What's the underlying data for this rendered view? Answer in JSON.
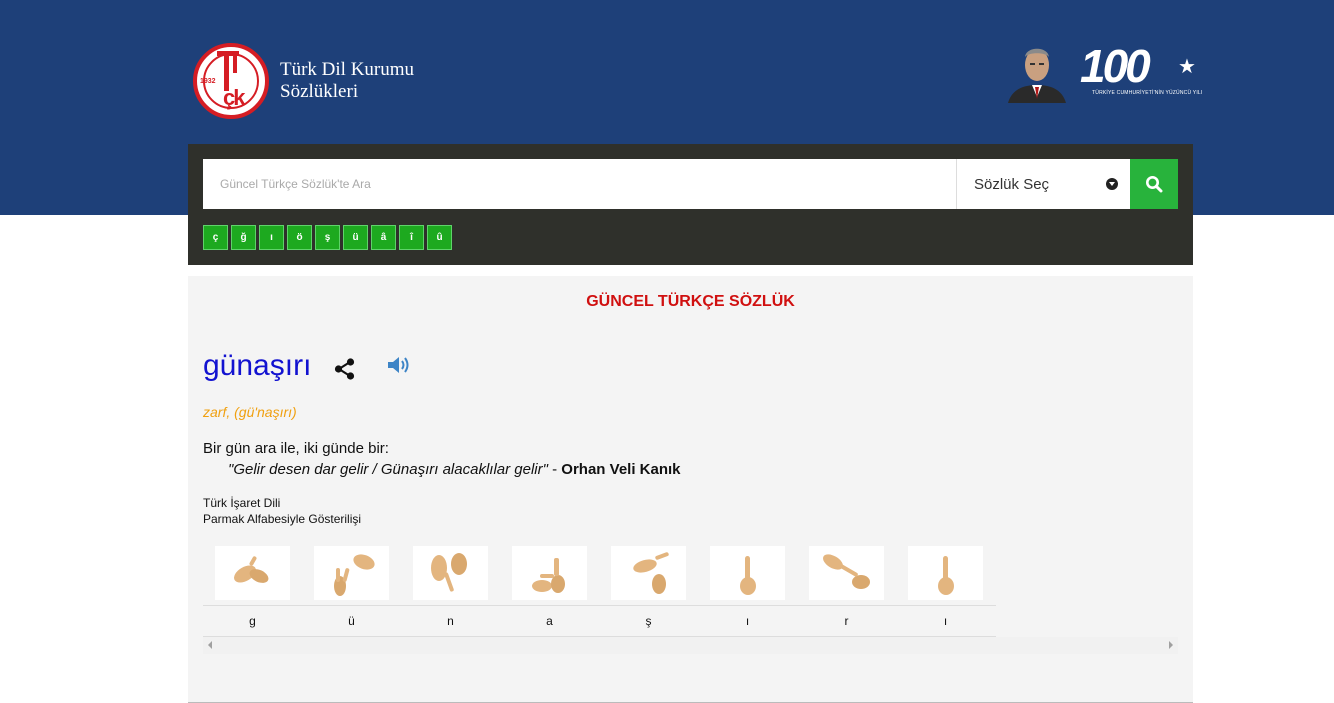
{
  "header": {
    "brand_line1": "Türk Dil Kurumu",
    "brand_line2": "Sözlükleri",
    "logo_year": "1932",
    "logo_letters": "çk",
    "centenary_number": "100",
    "centenary_subtitle": "TÜRKİYE CUMHURİYETİ'NİN YÜZÜNCÜ YILI"
  },
  "search": {
    "placeholder": "Güncel Türkçe Sözlük'te Ara",
    "value": "",
    "dictionary_select": "Sözlük Seç"
  },
  "special_letters": [
    "ç",
    "ğ",
    "ı",
    "ö",
    "ş",
    "ü",
    "â",
    "î",
    "û"
  ],
  "entry": {
    "dictionary_title": "GÜNCEL TÜRKÇE SÖZLÜK",
    "word": "günaşırı",
    "part_of_speech": "zarf, (gü'naşırı)",
    "definition": "Bir gün ara ile, iki günde bir:",
    "example_quote": "\"Gelir desen dar gelir / Günaşırı alacaklılar gelir\"",
    "example_separator": " - ",
    "example_author": "Orhan Veli Kanık",
    "sign_language_title": "Türk İşaret Dili",
    "sign_language_subtitle": "Parmak Alfabesiyle Gösterilişi",
    "fingerspelling": [
      "g",
      "ü",
      "n",
      "a",
      "ş",
      "ı",
      "r",
      "ı"
    ]
  },
  "colors": {
    "header_bg": "#1e4079",
    "search_panel_bg": "#2f302b",
    "search_button": "#28b33c",
    "letter_button": "#1da91f",
    "dictionary_title": "#d01010",
    "word": "#1212d0",
    "part_of_speech": "#f0a010",
    "skin": "#e3b57f"
  },
  "icons": {
    "search": "search-icon",
    "share": "share-icon",
    "speaker": "speaker-icon",
    "select_caret": "chevron-down-icon"
  }
}
